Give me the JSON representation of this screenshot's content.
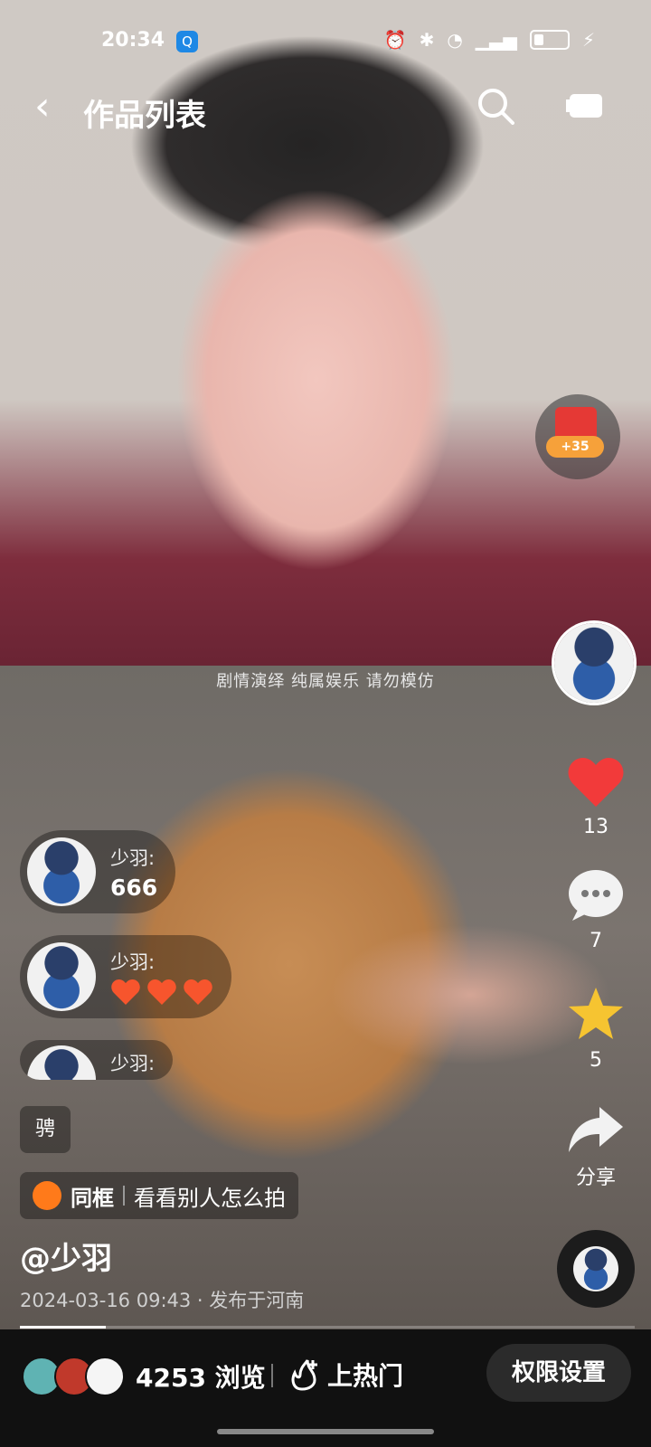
{
  "status_bar": {
    "time": "20:34"
  },
  "top_bar": {
    "title": "作品列表"
  },
  "red_packet": {
    "amount": "+35"
  },
  "video": {
    "overlay_caption": "剧情演绎  纯属娱乐  请勿模仿"
  },
  "actions": {
    "likes": "13",
    "comments": "7",
    "favorites": "5",
    "share_label": "分享"
  },
  "danmu": [
    {
      "name": "少羽:",
      "message": "666"
    },
    {
      "name": "少羽:",
      "message": ""
    },
    {
      "name": "少羽:",
      "message": ""
    }
  ],
  "tag_chip": "骋",
  "tongkuang": {
    "label": "同框",
    "action": "看看别人怎么拍"
  },
  "author": "@少羽",
  "meta": "2024-03-16 09:43 · 发布于河南",
  "progress_fraction": 0.14,
  "bottom": {
    "views": "4253 浏览",
    "hot_label": "上热门",
    "permission_button": "权限设置"
  },
  "colors": {
    "heart": "#f23a3a",
    "star": "#f6c431",
    "accent_orange": "#ff7a1a"
  }
}
